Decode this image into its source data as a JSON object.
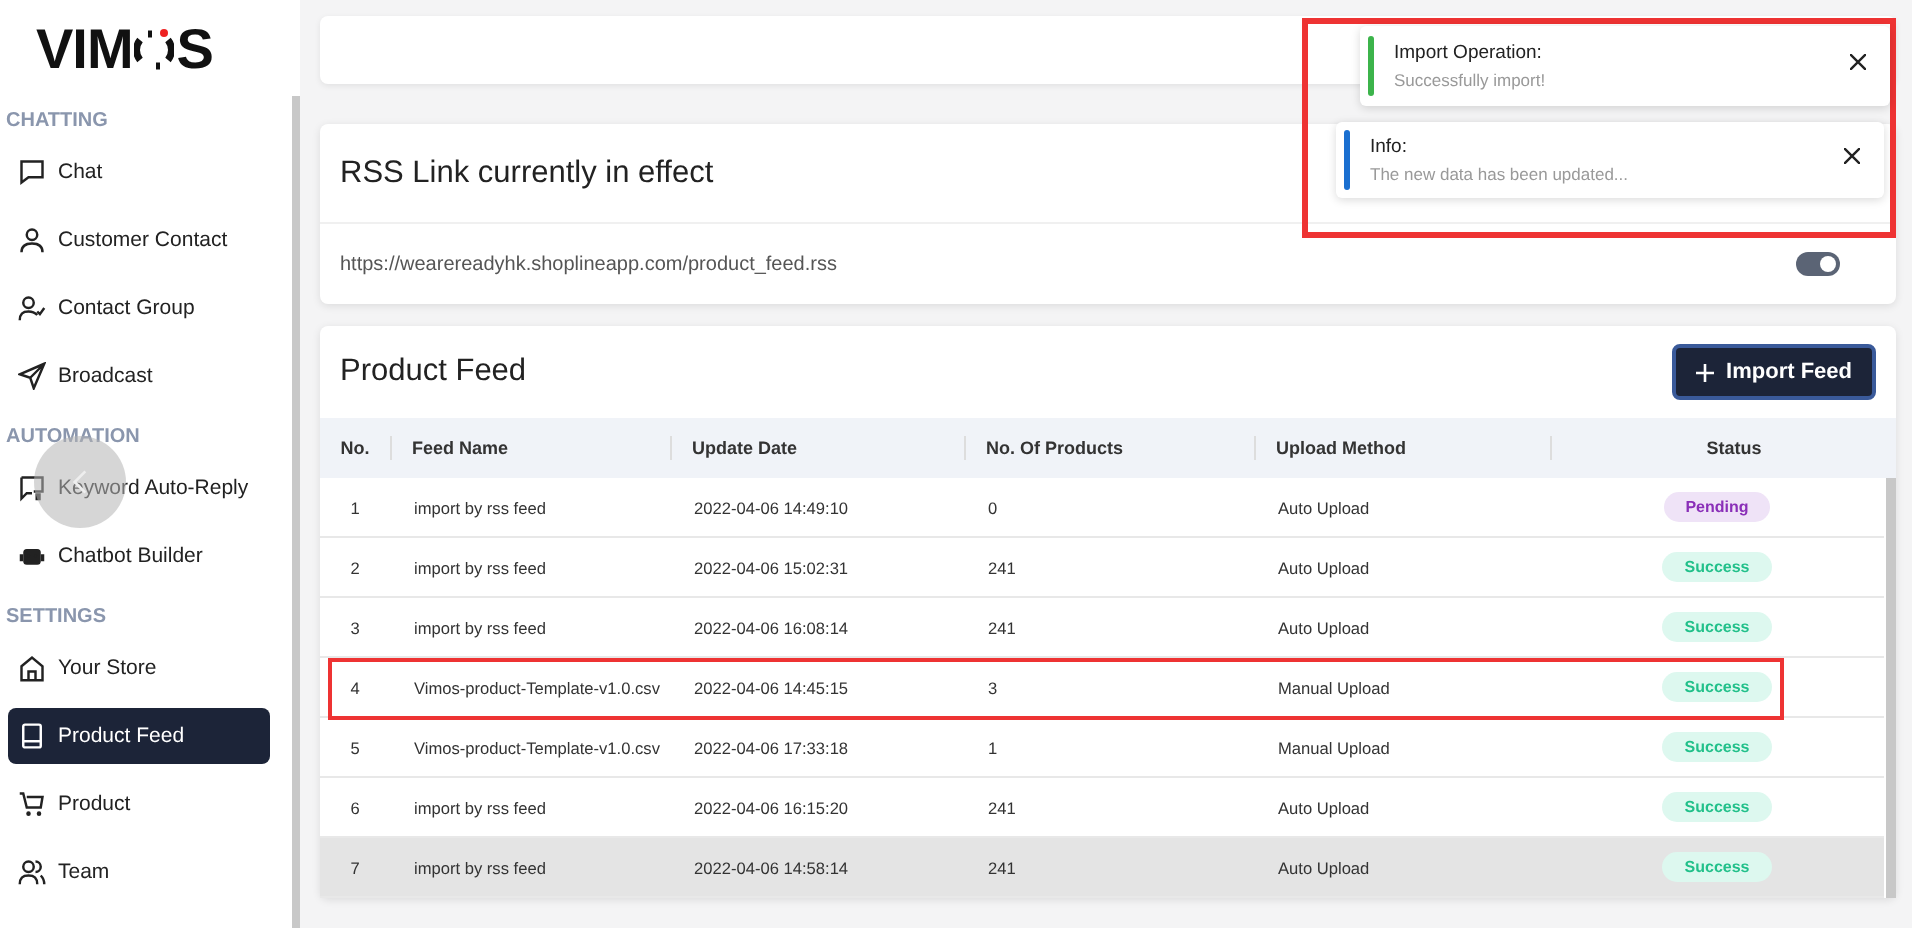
{
  "logo": {
    "before": "VIM",
    "after": "S"
  },
  "sidebar": {
    "sections": [
      {
        "title": "CHATTING",
        "items": [
          {
            "label": "Chat",
            "selected": false
          },
          {
            "label": "Customer Contact",
            "selected": false
          },
          {
            "label": "Contact Group",
            "selected": false
          },
          {
            "label": "Broadcast",
            "selected": false
          }
        ]
      },
      {
        "title": "AUTOMATION",
        "items": [
          {
            "label": "Keyword Auto-Reply",
            "selected": false
          },
          {
            "label": "Chatbot Builder",
            "selected": false
          }
        ]
      },
      {
        "title": "SETTINGS",
        "items": [
          {
            "label": "Your Store",
            "selected": false
          },
          {
            "label": "Product Feed",
            "selected": true
          },
          {
            "label": "Product",
            "selected": false
          },
          {
            "label": "Team",
            "selected": false
          }
        ]
      }
    ]
  },
  "rss_card": {
    "title": "RSS Link currently in effect",
    "url": "https://wearereadyhk.shoplineapp.com/product_feed.rss",
    "toggle_on": true
  },
  "feed_card": {
    "title": "Product Feed",
    "button": "Import Feed",
    "columns": [
      "No.",
      "Feed Name",
      "Update Date",
      "No. Of Products",
      "Upload Method",
      "Status"
    ],
    "rows": [
      {
        "cells": [
          "1",
          "import by rss feed",
          "2022-04-06 14:49:10",
          "0",
          "Auto Upload"
        ],
        "status": {
          "label": "Pending",
          "kind": "pending"
        },
        "highlighted": false,
        "hovered": false
      },
      {
        "cells": [
          "2",
          "import by rss feed",
          "2022-04-06 15:02:31",
          "241",
          "Auto Upload"
        ],
        "status": {
          "label": "Success",
          "kind": "success"
        },
        "highlighted": false,
        "hovered": false
      },
      {
        "cells": [
          "3",
          "import by rss feed",
          "2022-04-06 16:08:14",
          "241",
          "Auto Upload"
        ],
        "status": {
          "label": "Success",
          "kind": "success"
        },
        "highlighted": false,
        "hovered": false
      },
      {
        "cells": [
          "4",
          "Vimos-product-Template-v1.0.csv",
          "2022-04-06 14:45:15",
          "3",
          "Manual Upload"
        ],
        "status": {
          "label": "Success",
          "kind": "success"
        },
        "highlighted": true,
        "hovered": false
      },
      {
        "cells": [
          "5",
          "Vimos-product-Template-v1.0.csv",
          "2022-04-06 17:33:18",
          "1",
          "Manual Upload"
        ],
        "status": {
          "label": "Success",
          "kind": "success"
        },
        "highlighted": false,
        "hovered": false
      },
      {
        "cells": [
          "6",
          "import by rss feed",
          "2022-04-06 16:15:20",
          "241",
          "Auto Upload"
        ],
        "status": {
          "label": "Success",
          "kind": "success"
        },
        "highlighted": false,
        "hovered": false
      },
      {
        "cells": [
          "7",
          "import by rss feed",
          "2022-04-06 14:58:14",
          "241",
          "Auto Upload"
        ],
        "status": {
          "label": "Success",
          "kind": "success"
        },
        "highlighted": false,
        "hovered": true
      }
    ]
  },
  "toasts": {
    "highlighted": true,
    "items": [
      {
        "title": "Import Operation:",
        "message": "Successfully import!",
        "kind": "success"
      },
      {
        "title": "Info:",
        "message": "The new data has been updated...",
        "kind": "info"
      }
    ]
  }
}
